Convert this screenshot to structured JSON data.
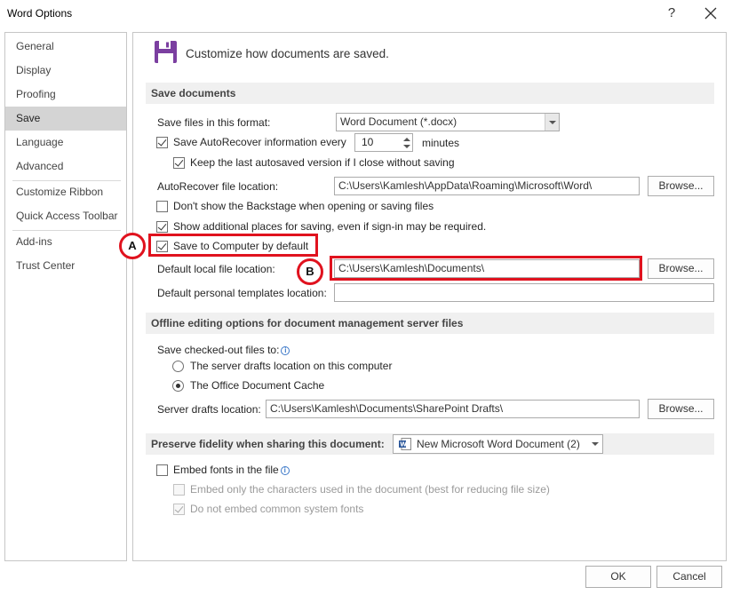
{
  "window": {
    "title": "Word Options",
    "help_symbol": "?",
    "close_symbol": "✕"
  },
  "sidebar": {
    "items": [
      {
        "label": "General"
      },
      {
        "label": "Display"
      },
      {
        "label": "Proofing"
      },
      {
        "label": "Save"
      },
      {
        "label": "Language"
      },
      {
        "label": "Advanced"
      },
      {
        "label": "Customize Ribbon"
      },
      {
        "label": "Quick Access Toolbar"
      },
      {
        "label": "Add-ins"
      },
      {
        "label": "Trust Center"
      }
    ],
    "active": "Save"
  },
  "header": {
    "icon": "floppy-disk-icon",
    "text": "Customize how documents are saved."
  },
  "save_documents": {
    "section_title": "Save documents",
    "format_label": "Save files in this format:",
    "format_value": "Word Document (*.docx)",
    "autorecover_label": "Save AutoRecover information every",
    "autorecover_checked": true,
    "autorecover_minutes": "10",
    "minutes_label": "minutes",
    "keep_last_label": "Keep the last autosaved version if I close without saving",
    "keep_last_checked": true,
    "autorecover_location_label": "AutoRecover file location:",
    "autorecover_location_value": "C:\\Users\\Kamlesh\\AppData\\Roaming\\Microsoft\\Word\\",
    "browse_label": "Browse...",
    "no_backstage_label": "Don't show the Backstage when opening or saving files",
    "no_backstage_checked": false,
    "show_additional_label": "Show additional places for saving, even if sign-in may be required.",
    "show_additional_checked": true,
    "save_to_computer_label": "Save to Computer by default",
    "save_to_computer_checked": true,
    "default_local_label": "Default local file location:",
    "default_local_value": "C:\\Users\\Kamlesh\\Documents\\",
    "default_templates_label": "Default personal templates location:",
    "default_templates_value": ""
  },
  "offline": {
    "section_title": "Offline editing options for document management server files",
    "checked_out_label": "Save checked-out files to:",
    "server_drafts_option": "The server drafts location on this computer",
    "office_cache_option": "The Office Document Cache",
    "selected_option": "office_cache",
    "server_drafts_location_label": "Server drafts location:",
    "server_drafts_location_value": "C:\\Users\\Kamlesh\\Documents\\SharePoint Drafts\\",
    "browse_label": "Browse..."
  },
  "fidelity": {
    "section_title": "Preserve fidelity when sharing this document:",
    "document_value": "New Microsoft Word Document (2)",
    "embed_fonts_label": "Embed fonts in the file",
    "embed_fonts_checked": false,
    "embed_only_label": "Embed only the characters used in the document (best for reducing file size)",
    "embed_only_checked": false,
    "do_not_embed_label": "Do not embed common system fonts",
    "do_not_embed_checked": true
  },
  "annotations": {
    "callout_a": "A",
    "callout_b": "B",
    "color": "#e0121e"
  },
  "footer": {
    "ok_label": "OK",
    "cancel_label": "Cancel"
  }
}
